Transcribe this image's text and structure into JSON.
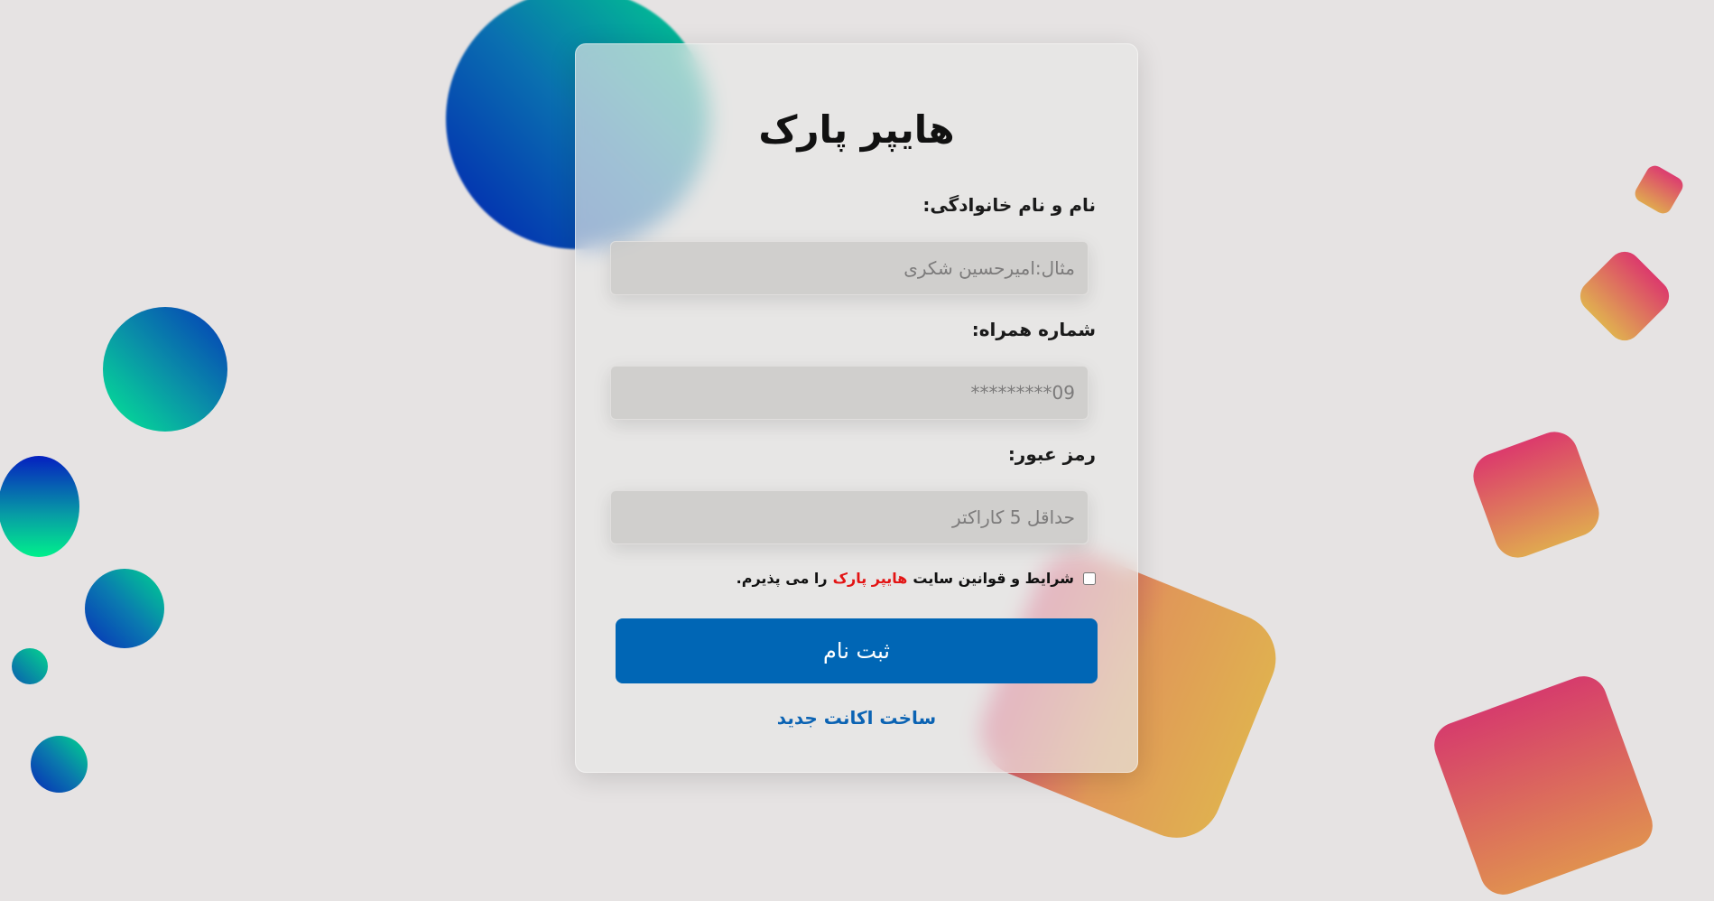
{
  "form": {
    "title": "هایپر پارک",
    "name_label": "نام و نام خانوادگی:",
    "name_placeholder": "مثال:امیرحسین شکری",
    "phone_label": "شماره همراه:",
    "phone_placeholder": "09*********",
    "password_label": "رمز عبور:",
    "password_placeholder": "حداقل 5 کاراکتر",
    "terms_prefix": "شرایط و قوانین سایت",
    "terms_site": "هایپر پارک",
    "terms_suffix": "را می پذیرم.",
    "terms_checked": false,
    "submit_label": "ثبت نام",
    "create_account_link": "ساخت اکانت جدید"
  },
  "colors": {
    "primary_button": "#0066b5",
    "link": "#0b63b3",
    "site_highlight": "#e31414",
    "background": "#e6e3e3"
  }
}
